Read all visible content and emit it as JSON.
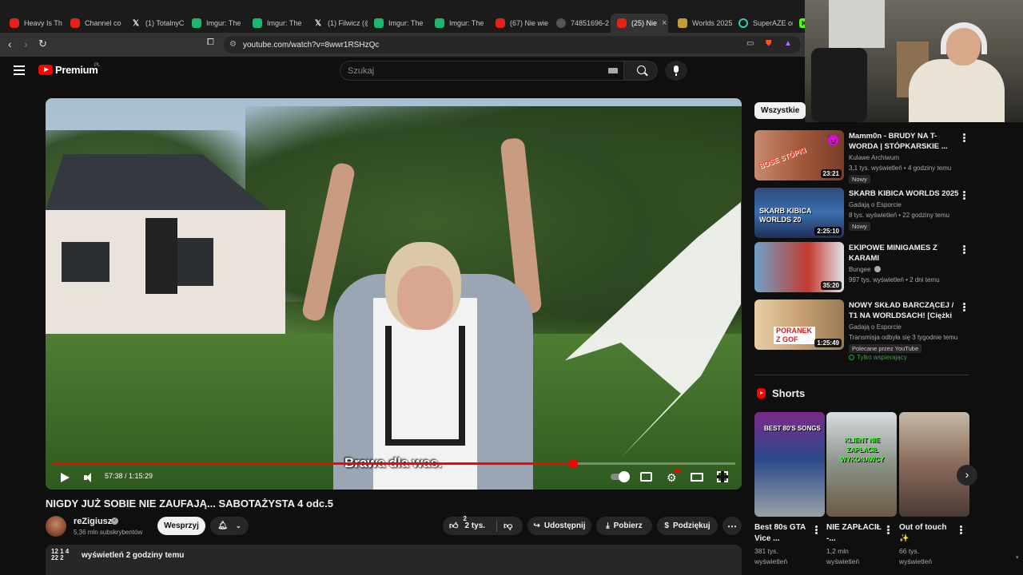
{
  "browser": {
    "tabs": [
      {
        "label": "Heavy Is Th",
        "icon": "youtube-icon"
      },
      {
        "label": "Channel co",
        "icon": "youtube-icon"
      },
      {
        "label": "(1) TotalnyC",
        "icon": "x-icon"
      },
      {
        "label": "Imgur: The",
        "icon": "imgur-icon"
      },
      {
        "label": "Imgur: The",
        "icon": "imgur-icon"
      },
      {
        "label": "(1) Filwicz (@",
        "icon": "x-icon"
      },
      {
        "label": "Imgur: The",
        "icon": "imgur-icon"
      },
      {
        "label": "Imgur: The",
        "icon": "imgur-icon"
      },
      {
        "label": "(67) Nie wie",
        "icon": "youtube-icon"
      },
      {
        "label": "74851696-2",
        "icon": "globe-icon"
      },
      {
        "label": "(25) Nie",
        "icon": "youtube-icon",
        "active": true
      },
      {
        "label": "Worlds 2025",
        "icon": "lol-icon"
      },
      {
        "label": "SuperAZE on",
        "icon": "ring-icon"
      },
      {
        "label": "",
        "icon": "kick-icon"
      }
    ],
    "tab_close": "×",
    "url": "youtube.com/watch?v=8wwr1RSHzQc"
  },
  "masthead": {
    "logo_text": "Premium",
    "region": "PL",
    "search_placeholder": "Szukaj"
  },
  "player": {
    "subtitle": "Brawa dla was.",
    "time": "57:38 / 1:15:29",
    "progress": 0.763
  },
  "video": {
    "title": "NIGDY JUŻ SOBIE NIE ZAUFAJĄ... SABOTAŻYSTA 4 odc.5",
    "channel": "reZigiusz",
    "verified": "✓",
    "subscribers": "5,36 mln subskrybentów",
    "support_label": "Wesprzyj",
    "likes_top": "2",
    "likes": "2 tys.",
    "share_label": "Udostępnij",
    "download_label": "Pobierz",
    "thanks_label": "Podziękuj",
    "desc_digits_top": "12  1  4",
    "desc_digits_bottom": "22  2",
    "desc_views": "wyświetleń  2 godziny temu"
  },
  "sidebar": {
    "chip": "Wszystkie",
    "recommendations": [
      {
        "title": "Mamm0n - BRUDY NA T-WORDA | STÓPKARSKIE ...",
        "channel": "Kulawe Archiwum",
        "meta": "3,1 tys. wyświetleń • 4 godziny temu",
        "badge": "Nowy",
        "duration": "23:21",
        "thumb_text": "BOSE STÓPKI"
      },
      {
        "title": "SKARB KIBICA WORLDS 2025",
        "channel": "Gadają o Esporcie",
        "meta": "8 tys. wyświetleń • 22 godziny temu",
        "badge": "Nowy",
        "duration": "2:25:10",
        "thumb_text": "SKARB KIBICA WORLDS 20"
      },
      {
        "title": "EKIPOWE MINIGAMES Z KARAMI",
        "channel": "Bungee",
        "meta": "997 tys. wyświetleń • 2 dni temu",
        "duration": "35:20",
        "thumb_text": ""
      },
      {
        "title": "NOWY SKŁAD BARCZĄCEJ / T1 NA WORLDSACH! [Ciężki ...",
        "channel": "Gadają o Esporcie",
        "meta": "Transmisja odbyła się 3 tygodnie temu",
        "badge": "Polecane przez YouTube",
        "members": "Tylko wspierający",
        "duration": "1:25:49",
        "thumb_text": "PORANEK Z GOF"
      }
    ],
    "shorts_title": "Shorts",
    "shorts": [
      {
        "title": "Best 80s GTA Vice ...",
        "views": "381 tys.",
        "views2": "wyświetleń",
        "thumb_text": "BEST 80'S SONGS"
      },
      {
        "title": "NIE ZAPŁACIŁ -...",
        "views": "1,2 mln",
        "views2": "wyświetleń",
        "thumb_text": "KLIENT NIE ZAPŁACIŁ WYKONAWCY"
      },
      {
        "title": "Out of touch ✨",
        "views": "66 tys.",
        "views2": "wyświetleń",
        "thumb_text": ""
      }
    ]
  },
  "colors": {
    "accent": "#ff0000",
    "background": "#0f0f0f",
    "surface": "#272727",
    "members_green": "#2ba640"
  }
}
